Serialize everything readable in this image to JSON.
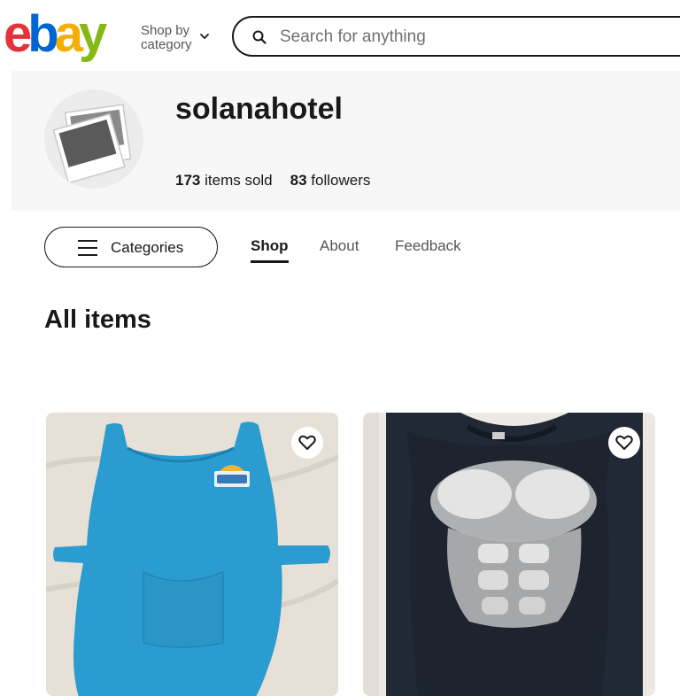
{
  "logo": {
    "e": "e",
    "b": "b",
    "a": "a",
    "y": "y"
  },
  "header": {
    "shop_by_line1": "Shop by",
    "shop_by_line2": "category",
    "search_placeholder": "Search for anything"
  },
  "store": {
    "name": "solanahotel",
    "items_sold_count": "173",
    "items_sold_label": "items sold",
    "followers_count": "83",
    "followers_label": "followers"
  },
  "nav": {
    "categories_label": "Categories",
    "tabs": [
      {
        "label": "Shop",
        "active": true
      },
      {
        "label": "About",
        "active": false
      },
      {
        "label": "Feedback",
        "active": false
      }
    ]
  },
  "section": {
    "title": "All items"
  },
  "colors": {
    "brand_red": "#e53238",
    "brand_blue": "#0064d2",
    "brand_yellow": "#f5af02",
    "brand_green": "#86b817"
  },
  "listings": [
    {
      "image": "blue apron tabard with Solana logo",
      "watch_icon": "heart-icon"
    },
    {
      "image": "black sleeveless shirt with muscle print",
      "watch_icon": "heart-icon"
    }
  ]
}
